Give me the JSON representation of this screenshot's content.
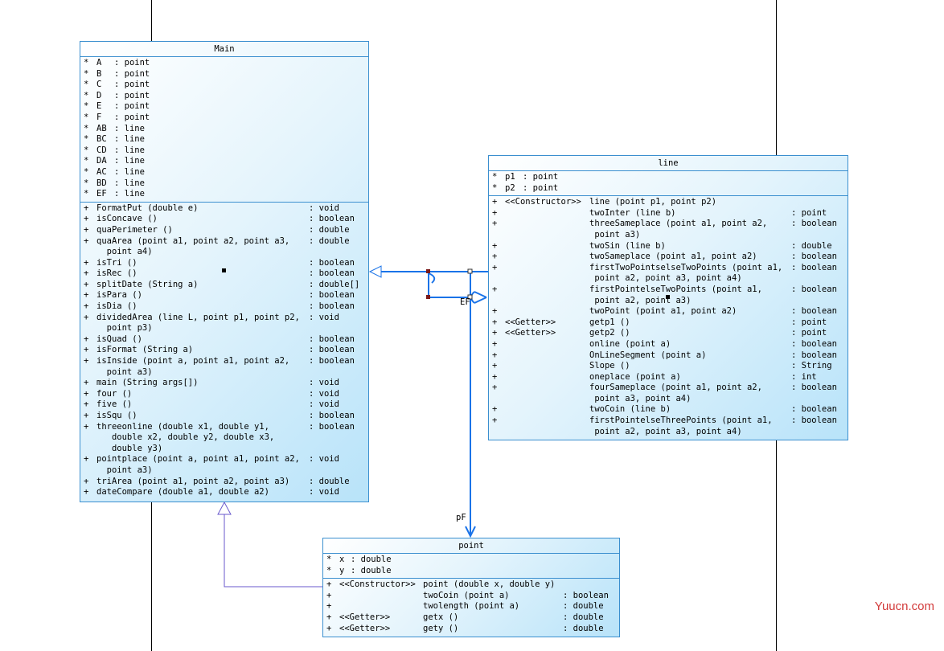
{
  "classes": {
    "main": {
      "name": "Main",
      "attributes": [
        {
          "vis": "*",
          "name": "A",
          "type": ": point"
        },
        {
          "vis": "*",
          "name": "B",
          "type": ": point"
        },
        {
          "vis": "*",
          "name": "C",
          "type": ": point"
        },
        {
          "vis": "*",
          "name": "D",
          "type": ": point"
        },
        {
          "vis": "*",
          "name": "E",
          "type": ": point"
        },
        {
          "vis": "*",
          "name": "F",
          "type": ": point"
        },
        {
          "vis": "*",
          "name": "AB",
          "type": ": line"
        },
        {
          "vis": "*",
          "name": "BC",
          "type": ": line"
        },
        {
          "vis": "*",
          "name": "CD",
          "type": ": line"
        },
        {
          "vis": "*",
          "name": "DA",
          "type": ": line"
        },
        {
          "vis": "*",
          "name": "AC",
          "type": ": line"
        },
        {
          "vis": "*",
          "name": "BD",
          "type": ": line"
        },
        {
          "vis": "*",
          "name": "EF",
          "type": ": line"
        }
      ],
      "methods": [
        {
          "vis": "+",
          "name": "FormatPut (double e)",
          "type": ": void"
        },
        {
          "vis": "+",
          "name": "isConcave ()",
          "type": ": boolean"
        },
        {
          "vis": "+",
          "name": "quaPerimeter ()",
          "type": ": double"
        },
        {
          "vis": "+",
          "name": "quaArea (point a1, point a2, point a3,\n  point a4)",
          "type": ": double"
        },
        {
          "vis": "+",
          "name": "isTri ()",
          "type": ": boolean"
        },
        {
          "vis": "+",
          "name": "isRec ()",
          "type": ": boolean"
        },
        {
          "vis": "+",
          "name": "splitDate (String a)",
          "type": ": double[]"
        },
        {
          "vis": "+",
          "name": "isPara ()",
          "type": ": boolean"
        },
        {
          "vis": "+",
          "name": "isDia ()",
          "type": ": boolean"
        },
        {
          "vis": "+",
          "name": "dividedArea (line L, point p1, point p2,\n  point p3)",
          "type": ": void"
        },
        {
          "vis": "+",
          "name": "isQuad ()",
          "type": ": boolean"
        },
        {
          "vis": "+",
          "name": "isFormat (String a)",
          "type": ": boolean"
        },
        {
          "vis": "+",
          "name": "isInside (point a, point a1, point a2,\n  point a3)",
          "type": ": boolean"
        },
        {
          "vis": "+",
          "name": "main (String args[])",
          "type": ": void"
        },
        {
          "vis": "+",
          "name": "four ()",
          "type": ": void"
        },
        {
          "vis": "+",
          "name": "five ()",
          "type": ": void"
        },
        {
          "vis": "+",
          "name": "isSqu ()",
          "type": ": boolean"
        },
        {
          "vis": "+",
          "name": "threeonline (double x1, double y1,\n   double x2, double y2, double x3,\n   double y3)",
          "type": ": boolean"
        },
        {
          "vis": "+",
          "name": "pointplace (point a, point a1, point a2,\n  point a3)",
          "type": ": void"
        },
        {
          "vis": "+",
          "name": "triArea (point a1, point a2, point a3)",
          "type": ": double"
        },
        {
          "vis": "+",
          "name": "dateCompare (double a1, double a2)",
          "type": ": void"
        }
      ]
    },
    "line": {
      "name": "line",
      "attributes": [
        {
          "vis": "*",
          "name": "p1",
          "type": ": point"
        },
        {
          "vis": "*",
          "name": "p2",
          "type": ": point"
        }
      ],
      "methods": [
        {
          "vis": "+",
          "st": "<<Constructor>>",
          "name": "line (point p1, point p2)",
          "type": ""
        },
        {
          "vis": "+",
          "st": "",
          "name": "twoInter (line b)",
          "type": ": point"
        },
        {
          "vis": "+",
          "st": "",
          "name": "threeSameplace (point a1, point a2,\n point a3)",
          "type": ": boolean"
        },
        {
          "vis": "+",
          "st": "",
          "name": "twoSin (line b)",
          "type": ": double"
        },
        {
          "vis": "+",
          "st": "",
          "name": "twoSameplace (point a1, point a2)",
          "type": ": boolean"
        },
        {
          "vis": "+",
          "st": "",
          "name": "firstTwoPointselseTwoPoints (point a1,\n point a2, point a3, point a4)",
          "type": ": boolean"
        },
        {
          "vis": "+",
          "st": "",
          "name": "firstPointelseTwoPoints (point a1,\n point a2, point a3)",
          "type": ": boolean"
        },
        {
          "vis": "+",
          "st": "",
          "name": "twoPoint (point a1, point a2)",
          "type": ": boolean"
        },
        {
          "vis": "+",
          "st": "<<Getter>>",
          "name": "getp1 ()",
          "type": ": point"
        },
        {
          "vis": "+",
          "st": "<<Getter>>",
          "name": "getp2 ()",
          "type": ": point"
        },
        {
          "vis": "+",
          "st": "",
          "name": "online (point a)",
          "type": ": boolean"
        },
        {
          "vis": "+",
          "st": "",
          "name": "OnLineSegment (point a)",
          "type": ": boolean"
        },
        {
          "vis": "+",
          "st": "",
          "name": "Slope ()",
          "type": ": String"
        },
        {
          "vis": "+",
          "st": "",
          "name": "oneplace (point a)",
          "type": ": int"
        },
        {
          "vis": "+",
          "st": "",
          "name": "fourSameplace (point a1, point a2,\n point a3, point a4)",
          "type": ": boolean"
        },
        {
          "vis": "+",
          "st": "",
          "name": "twoCoin (line b)",
          "type": ": boolean"
        },
        {
          "vis": "+",
          "st": "",
          "name": "firstPointelseThreePoints (point a1,\n point a2, point a3, point a4)",
          "type": ": boolean"
        }
      ]
    },
    "point": {
      "name": "point",
      "attributes": [
        {
          "vis": "*",
          "name": "x",
          "type": ": double"
        },
        {
          "vis": "*",
          "name": "y",
          "type": ": double"
        }
      ],
      "methods": [
        {
          "vis": "+",
          "st": "<<Constructor>>",
          "name": "point (double x, double y)",
          "type": ""
        },
        {
          "vis": "+",
          "st": "",
          "name": "twoCoin (point a)",
          "type": ": boolean"
        },
        {
          "vis": "+",
          "st": "",
          "name": "twolength (point a)",
          "type": ": double"
        },
        {
          "vis": "+",
          "st": "<<Getter>>",
          "name": "getx ()",
          "type": ": double"
        },
        {
          "vis": "+",
          "st": "<<Getter>>",
          "name": "gety ()",
          "type": ": double"
        }
      ]
    }
  },
  "labels": {
    "ef": "EF",
    "pf": "pF"
  },
  "watermark": "Yuucn.com",
  "colors": {
    "border": "#3b8fcf",
    "association": "#1a73e8",
    "generalization": "#6a5acd",
    "watermark": "#d23a3a"
  }
}
